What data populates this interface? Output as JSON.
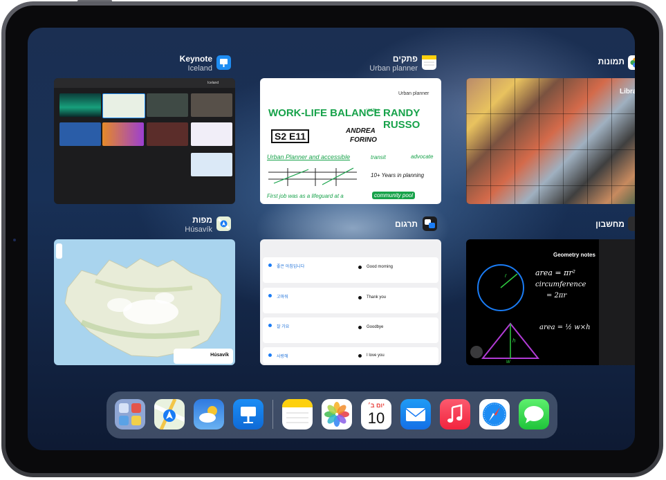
{
  "switcher": {
    "keynote": {
      "title": "Keynote",
      "subtitle": "Iceland",
      "doc_name": "Iceland",
      "toolbar_right": "Print and Export"
    },
    "notes": {
      "title": "פתקים",
      "subtitle": "Urban planner",
      "note_title": "Urban planner",
      "lines": [
        "WORK-LIFE BALANCE",
        "WITH",
        "RANDY RUSSO",
        "S2 E11",
        "ANDREA",
        "FORINO",
        "Urban Planner and accessible",
        "transit",
        "advocate",
        "10+ Years in planning",
        "First job was as a lifeguard at a",
        "community pool"
      ]
    },
    "photos": {
      "title": "תמונות",
      "sidebar_label": "Libra"
    },
    "maps": {
      "title": "מפות",
      "subtitle": "Húsavík",
      "place_label": "Húsavík"
    },
    "translate": {
      "title": "תרגום",
      "rows": [
        {
          "source": "좋은 아침입니다",
          "target": "Good morning"
        },
        {
          "source": "고마워",
          "target": "Thank you"
        },
        {
          "source": "잘 가요",
          "target": "Goodbye"
        },
        {
          "source": "사랑해",
          "target": "I love you"
        }
      ]
    },
    "calculator": {
      "title": "מחשבון",
      "note_title": "Geometry notes",
      "formulas": [
        "area = πr²",
        "circumference",
        "= 2πr",
        "area = ½ w×h"
      ],
      "labels": [
        "r",
        "h",
        "w"
      ]
    }
  },
  "dock": {
    "apps": [
      "app-library",
      "maps",
      "weather",
      "keynote",
      "notes",
      "photos",
      "calendar",
      "mail",
      "music",
      "safari",
      "messages"
    ],
    "calendar_day": "יום ב׳",
    "calendar_date": "10"
  },
  "colors": {
    "keynote_blue": "#1f8df2",
    "notes_yellow": "#fdd00e",
    "marker_green": "#17a24a",
    "accent_blue": "#1a7cf5"
  }
}
